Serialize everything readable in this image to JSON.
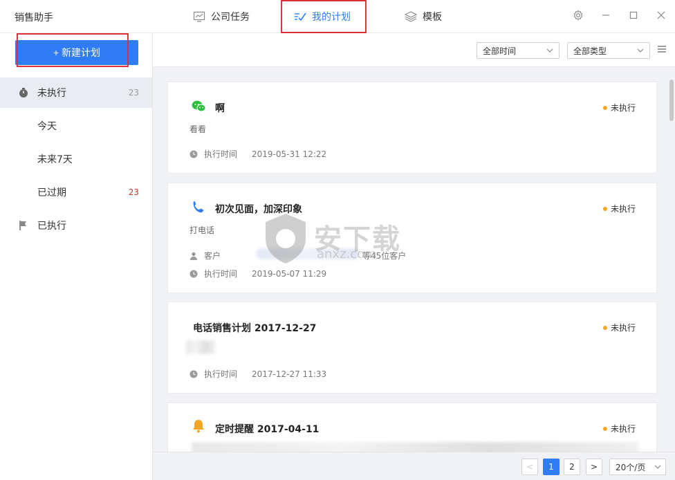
{
  "app": {
    "title": "销售助手"
  },
  "tabs": [
    {
      "label": "公司任务",
      "icon": "chart-monitor-icon"
    },
    {
      "label": "我的计划",
      "icon": "checklist-icon",
      "active": true
    },
    {
      "label": "模板",
      "icon": "layers-icon"
    }
  ],
  "sidebar": {
    "new_button": "+ 新建计划",
    "items": [
      {
        "label": "未执行",
        "count": "23",
        "icon": "stopwatch-icon"
      },
      {
        "label": "今天",
        "count": ""
      },
      {
        "label": "未来7天",
        "count": ""
      },
      {
        "label": "已过期",
        "count": "23"
      },
      {
        "label": "已执行",
        "count": "",
        "icon": "flag-icon"
      }
    ]
  },
  "filters": {
    "time": "全部时间",
    "type": "全部类型"
  },
  "cards": [
    {
      "icon": "wechat-icon",
      "title": "啊",
      "status": "未执行",
      "desc": "看看",
      "time_label": "执行时间",
      "time": "2019-05-31 12:22"
    },
    {
      "icon": "phone-icon",
      "title": "初次见面，加深印象",
      "status": "未执行",
      "desc": "打电话",
      "customer_label": "客户",
      "customer_value": "等45位客户",
      "time_label": "执行时间",
      "time": "2019-05-07 11:29"
    },
    {
      "title": "电话销售计划 2017-12-27",
      "status": "未执行",
      "time_label": "执行时间",
      "time": "2017-12-27 11:33"
    },
    {
      "icon": "bell-icon",
      "title": "定时提醒 2017-04-11",
      "status": "未执行"
    }
  ],
  "pagination": {
    "prev": "<",
    "pages": [
      "1",
      "2"
    ],
    "next": ">",
    "size": "20个/页"
  },
  "watermark": {
    "text": "安下载",
    "sub": "anxz.com"
  },
  "colors": {
    "accent": "#2f7cf6",
    "status_dot": "#f5a623",
    "highlight_box": "#e0303a"
  }
}
